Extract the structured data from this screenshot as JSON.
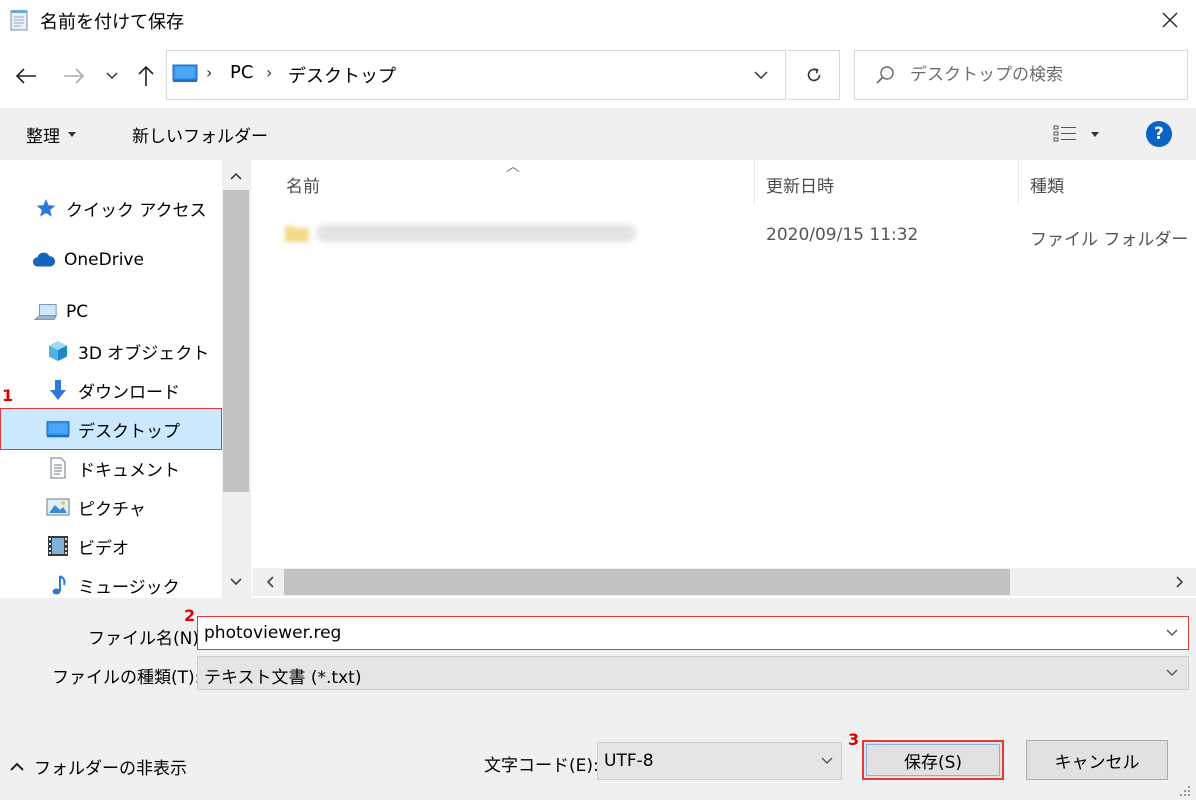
{
  "window": {
    "title": "名前を付けて保存",
    "close_icon": "close-icon"
  },
  "address_bar": {
    "breadcrumbs": [
      "PC",
      "デスクトップ"
    ],
    "search_placeholder": "デスクトップの検索"
  },
  "toolbar": {
    "organize_label": "整理",
    "new_folder_label": "新しいフォルダー",
    "help_label": "?"
  },
  "nav_pane": {
    "items": [
      {
        "label": "クイック アクセス",
        "icon": "star-icon"
      },
      {
        "label": "OneDrive",
        "icon": "cloud-icon"
      },
      {
        "label": "PC",
        "icon": "computer-icon"
      },
      {
        "label": "3D オブジェクト",
        "icon": "cube-icon"
      },
      {
        "label": "ダウンロード",
        "icon": "download-arrow-icon"
      },
      {
        "label": "デスクトップ",
        "icon": "desktop-icon",
        "selected": true
      },
      {
        "label": "ドキュメント",
        "icon": "document-icon"
      },
      {
        "label": "ピクチャ",
        "icon": "picture-icon"
      },
      {
        "label": "ビデオ",
        "icon": "film-icon"
      },
      {
        "label": "ミュージック",
        "icon": "music-note-icon"
      }
    ]
  },
  "file_list": {
    "columns": [
      "名前",
      "更新日時",
      "種類"
    ],
    "rows": [
      {
        "date": "2020/09/15 11:32",
        "type": "ファイル フォルダー"
      }
    ]
  },
  "form": {
    "filename_label": "ファイル名(N):",
    "filename_value": "photoviewer.reg",
    "filetype_label": "ファイルの種類(T):",
    "filetype_value": "テキスト文書 (*.txt)",
    "encoding_label": "文字コード(E):",
    "encoding_value": "UTF-8",
    "hide_folders_label": "フォルダーの非表示",
    "save_label": "保存(S)",
    "cancel_label": "キャンセル"
  },
  "annotations": {
    "step1": "1",
    "step2": "2",
    "step3": "3",
    "color": "#e53935"
  },
  "colors": {
    "accent": "#0a64c8",
    "selection": "#cce8ff",
    "panel": "#f0f0f0"
  }
}
